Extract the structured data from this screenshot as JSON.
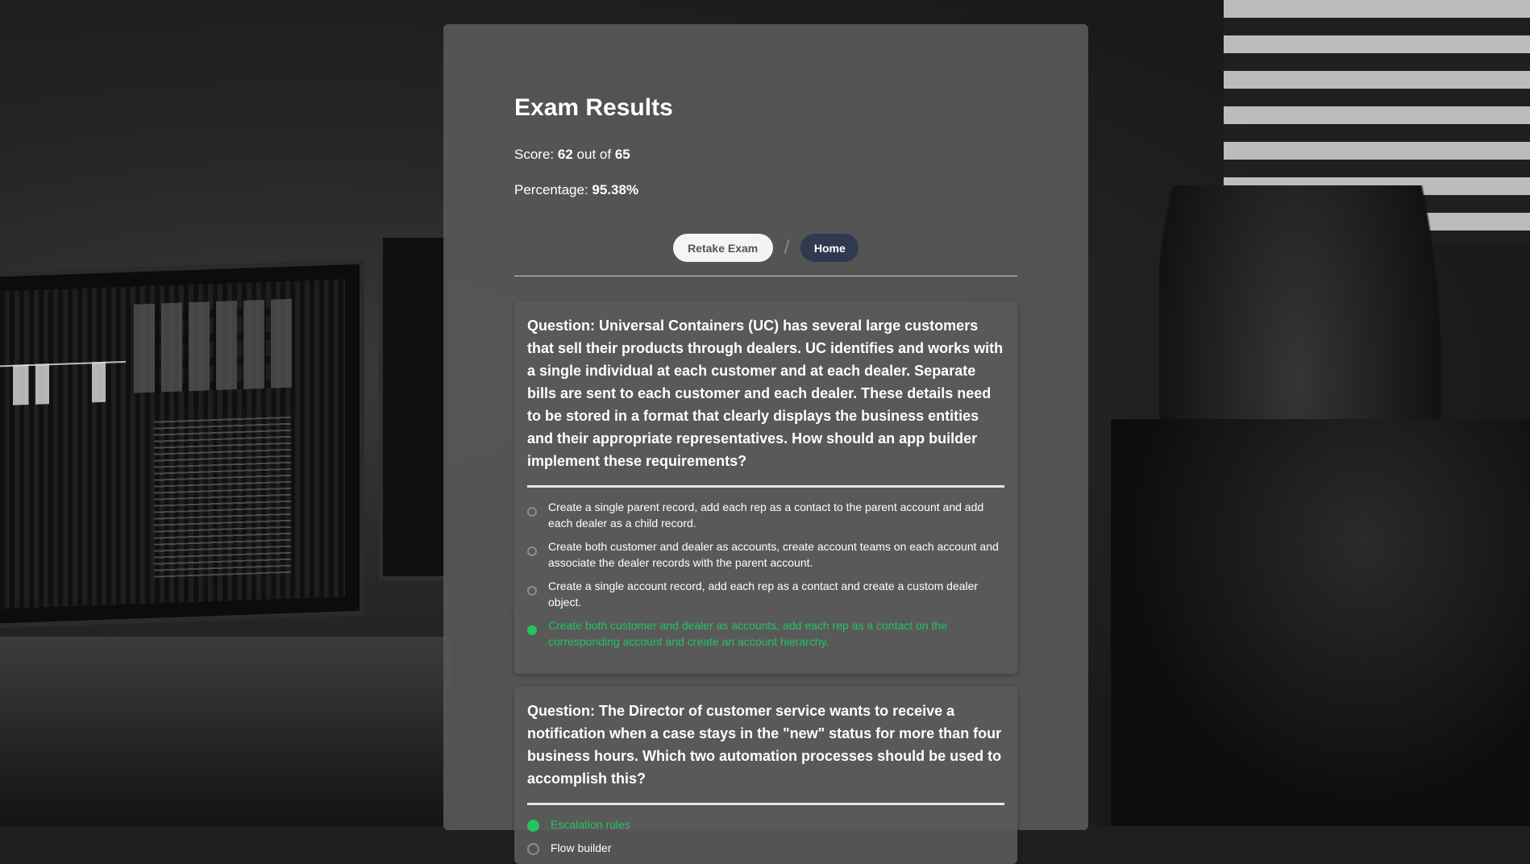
{
  "page": {
    "title": "Exam Results",
    "score_label": "Score:",
    "score_value": "62",
    "score_of": "out of",
    "score_total": "65",
    "percentage_label": "Percentage:",
    "percentage_value": "95.38%"
  },
  "actions": {
    "retake_label": "Retake Exam",
    "separator": "/",
    "home_label": "Home"
  },
  "questions": [
    {
      "label": "Question:",
      "text": "Universal Containers (UC) has several large customers that sell their products through dealers. UC identifies and works with a single individual at each customer and at each dealer. Separate bills are sent to each customer and each dealer. These details need to be stored in a format that clearly displays the business entities and their appropriate representatives. How should an app builder implement these requirements?",
      "options": [
        "Create a single parent record, add each rep as a contact to the parent account and add each dealer as a child record.",
        "Create both customer and dealer as accounts, create account teams on each account and associate the dealer records with the parent account.",
        "Create a single account record, add each rep as a contact and create a custom dealer object.",
        "Create both customer and dealer as accounts, add each rep as a contact on the corresponding account and create an account hierarchy."
      ],
      "selected_index": 3
    },
    {
      "label": "Question:",
      "text": "The Director of customer service wants to receive a notification when a case stays in the \"new\" status for more than four business hours. Which two automation processes should be used to accomplish this?",
      "options": [
        "Escalation rules",
        "Flow builder"
      ],
      "selected_index": 0
    }
  ],
  "colors": {
    "correct": "#22c55e",
    "card_bg": "#585858",
    "home_button": "#2f3a4f"
  }
}
